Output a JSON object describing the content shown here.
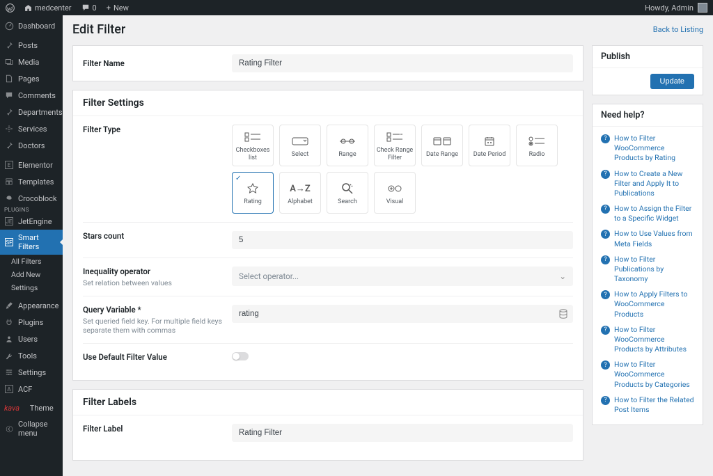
{
  "topbar": {
    "site_name": "medcenter",
    "comments_count": "0",
    "new_label": "New",
    "howdy": "Howdy, Admin"
  },
  "sidebar": {
    "items": [
      {
        "label": "Dashboard"
      },
      {
        "label": "Posts"
      },
      {
        "label": "Media"
      },
      {
        "label": "Pages"
      },
      {
        "label": "Comments"
      },
      {
        "label": "Departments"
      },
      {
        "label": "Services"
      },
      {
        "label": "Doctors"
      },
      {
        "label": "Elementor"
      },
      {
        "label": "Templates"
      },
      {
        "label": "Crocoblock"
      },
      {
        "label": "JetEngine"
      },
      {
        "label": "Smart Filters"
      },
      {
        "label": "Appearance"
      },
      {
        "label": "Plugins"
      },
      {
        "label": "Users"
      },
      {
        "label": "Tools"
      },
      {
        "label": "Settings"
      },
      {
        "label": "ACF"
      }
    ],
    "sub": {
      "all_filters": "All Filters",
      "add_new": "Add New",
      "settings": "Settings"
    },
    "theme_label": "Theme",
    "theme_brand": "kava",
    "collapse": "Collapse menu"
  },
  "page": {
    "title": "Edit Filter",
    "back": "Back to Listing"
  },
  "form": {
    "name_label": "Filter Name",
    "name_value": "Rating Filter",
    "settings_heading": "Filter Settings",
    "type_label": "Filter Type",
    "types": [
      {
        "label": "Checkboxes list"
      },
      {
        "label": "Select"
      },
      {
        "label": "Range"
      },
      {
        "label": "Check Range Filter"
      },
      {
        "label": "Date Range"
      },
      {
        "label": "Date Period"
      },
      {
        "label": "Radio"
      },
      {
        "label": "Rating"
      },
      {
        "label": "Alphabet"
      },
      {
        "label": "Search"
      },
      {
        "label": "Visual"
      }
    ],
    "stars_label": "Stars count",
    "stars_value": "5",
    "ineq_label": "Inequality operator",
    "ineq_hint": "Set relation between values",
    "ineq_placeholder": "Select operator...",
    "qv_label": "Query Variable *",
    "qv_hint": "Set queried field key. For multiple field keys separate them with commas",
    "qv_value": "rating",
    "default_label": "Use Default Filter Value",
    "labels_heading": "Filter Labels",
    "label_label": "Filter Label",
    "label_value": "Rating Filter"
  },
  "publish": {
    "heading": "Publish",
    "update": "Update"
  },
  "help": {
    "heading": "Need help?",
    "links": [
      "How to Filter WooCommerce Products by Rating",
      "How to Create a New Filter and Apply It to Publications",
      "How to Assign the Filter to a Specific Widget",
      "How to Use Values from Meta Fields",
      "How to Filter Publications by Taxonomy",
      "How to Apply Filters to WooCommerce Products",
      "How to Filter WooCommerce Products by Attributes",
      "How to Filter WooCommerce Products by Categories",
      "How to Filter the Related Post Items"
    ]
  }
}
